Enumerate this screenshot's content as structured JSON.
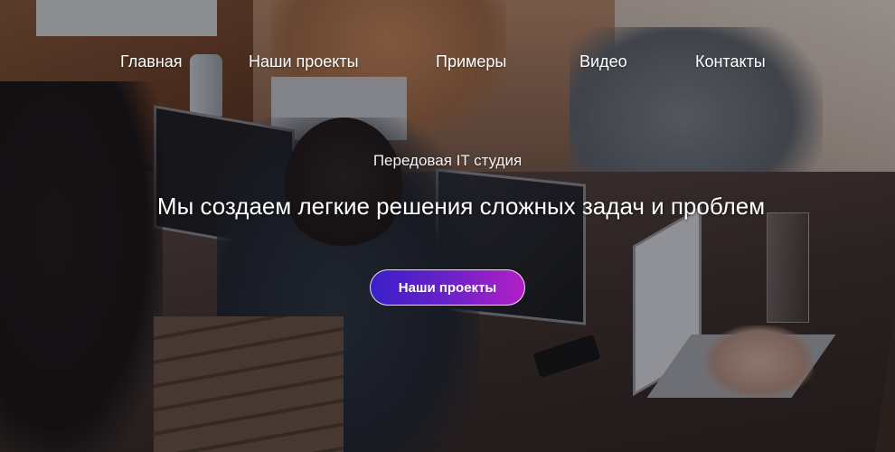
{
  "nav": {
    "items": [
      {
        "label": "Главная"
      },
      {
        "label": "Наши проекты"
      },
      {
        "label": "Примеры"
      },
      {
        "label": "Видео"
      },
      {
        "label": "Контакты"
      }
    ]
  },
  "hero": {
    "subtitle": "Передовая IT студия",
    "headline": "Мы создаем легкие решения сложных задач и проблем",
    "cta_label": "Наши проекты",
    "cta_gradient": [
      "#3a1fc9",
      "#b21fc6"
    ]
  }
}
